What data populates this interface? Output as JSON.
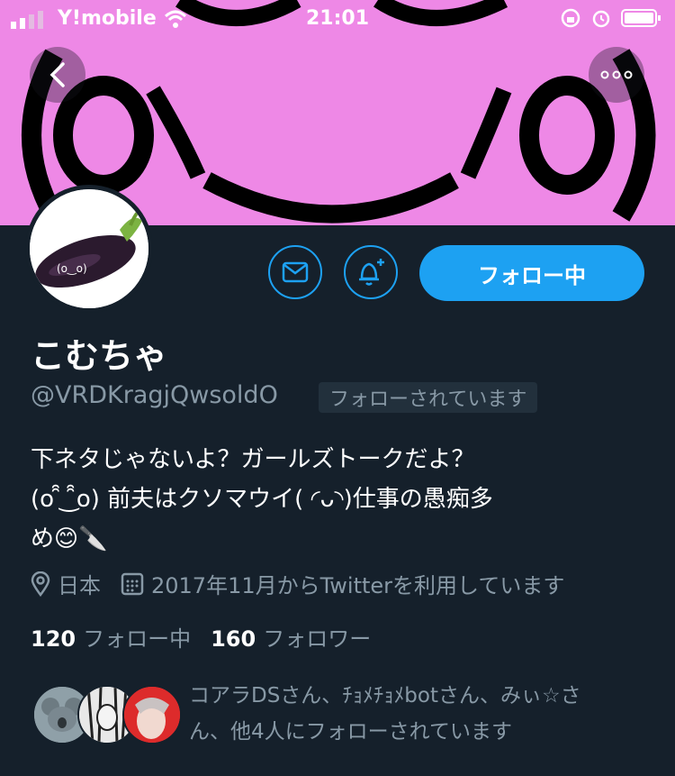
{
  "status_bar": {
    "carrier": "Y!mobile",
    "time": "21:01"
  },
  "banner": {
    "color": "#ee88e6",
    "art_text": "(o‿o)"
  },
  "profile": {
    "name": "こむちゃ",
    "handle": "@VRDKragjQwsoldO",
    "follows_you": "フォローされています",
    "bio_lines": [
      "下ネタじゃないよ？ガールズトークだよ？",
      "(o ̑̑ ͜ ̑̑o) 前夫はクソマウイ( ◜ᴗ◝)仕事の愚痴多",
      "め😊🔪"
    ],
    "location": "日本",
    "joined": "2017年11月からTwitterを利用しています",
    "following_count": "120",
    "following_label": "フォロー中",
    "followers_count": "160",
    "followers_label": "フォロワー",
    "avatar_face": "(o‿o)"
  },
  "actions": {
    "follow_button": "フォロー中"
  },
  "known_followers": {
    "text_line1": "コアラDSさん、ﾁｮﾒﾁｮﾒbotさん、みぃ☆さ",
    "text_line2": "ん、他4人にフォローされています"
  },
  "colors": {
    "accent": "#1da1f2",
    "background": "#15202b",
    "muted": "#8899a6"
  }
}
